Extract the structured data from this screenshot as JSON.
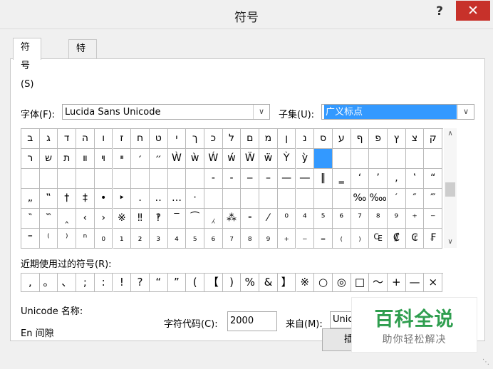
{
  "window": {
    "title": "符号",
    "help": "?",
    "close": "✕"
  },
  "tabs": [
    {
      "label": "符号(S)"
    },
    {
      "label": "特殊字符(P)"
    }
  ],
  "font": {
    "label": "字体(F):",
    "value": "Lucida Sans Unicode"
  },
  "subset": {
    "label": "子集(U):",
    "value": "广义标点"
  },
  "grid_rows": [
    [
      "ב",
      "ג",
      "ד",
      "ה",
      "ו",
      "ז",
      "ח",
      "ט",
      "י",
      "ך",
      "כ",
      "ל",
      "ם",
      "מ",
      "ן",
      "נ",
      "ס",
      "ע",
      "ף",
      "פ",
      "ץ",
      "צ",
      "ק"
    ],
    [
      "ר",
      "ש",
      "ת",
      "װ",
      "ױ",
      "ײ",
      "׳",
      "״",
      "Ẁ",
      "ẁ",
      "Ẃ",
      "ẃ",
      "Ẅ",
      "ẅ",
      "Ỳ",
      "ỳ",
      "",
      "",
      "",
      "",
      "",
      "",
      ""
    ],
    [
      "",
      "",
      "",
      "",
      "",
      "",
      "",
      "",
      "",
      "",
      "‐",
      "‑",
      "‒",
      "–",
      "—",
      "―",
      "‖",
      "‗",
      "‘",
      "’",
      "‚",
      "‛",
      "“"
    ],
    [
      "„",
      "‟",
      "†",
      "‡",
      "•",
      "‣",
      "․",
      "‥",
      "…",
      "‧",
      "",
      "",
      "",
      "",
      "",
      "",
      "",
      "",
      "‰",
      "‱",
      "′",
      "″",
      "‴"
    ],
    [
      "‶",
      "‷",
      "‸",
      "‹",
      "›",
      "※",
      "‼",
      "‽",
      "‾",
      "⁀",
      "⁁",
      "⁂",
      "⁃",
      "⁄",
      "⁰",
      "⁴",
      "⁵",
      "⁶",
      "⁷",
      "⁸",
      "⁹",
      "⁺",
      "⁻"
    ],
    [
      "⁼",
      "⁽",
      "⁾",
      "ⁿ",
      "₀",
      "₁",
      "₂",
      "₃",
      "₄",
      "₅",
      "₆",
      "₇",
      "₈",
      "₉",
      "₊",
      "₋",
      "₌",
      "₍",
      "₎",
      "₠",
      "₡",
      "₢",
      "₣"
    ]
  ],
  "selected_cell": {
    "row": 1,
    "col": 16
  },
  "recent": {
    "label": "近期使用过的符号(R):",
    "symbols": [
      ",",
      "。",
      "、",
      ";",
      ":",
      "!",
      "?",
      "“",
      "”",
      "(",
      "【",
      ")",
      "%",
      "&",
      "】",
      "※",
      "○",
      "◎",
      "□",
      "～",
      "+",
      "—",
      "×"
    ]
  },
  "unicode_name": {
    "label": "Unicode 名称:",
    "value": "En 间隙"
  },
  "char_code": {
    "label": "字符代码(C):",
    "value": "2000"
  },
  "from": {
    "label": "来自(M):",
    "value": "Unicode(十六进制)"
  },
  "insert_button": {
    "label": "插入(I)"
  },
  "watermark": {
    "title": "百科全说",
    "subtitle": "助你轻松解决"
  }
}
